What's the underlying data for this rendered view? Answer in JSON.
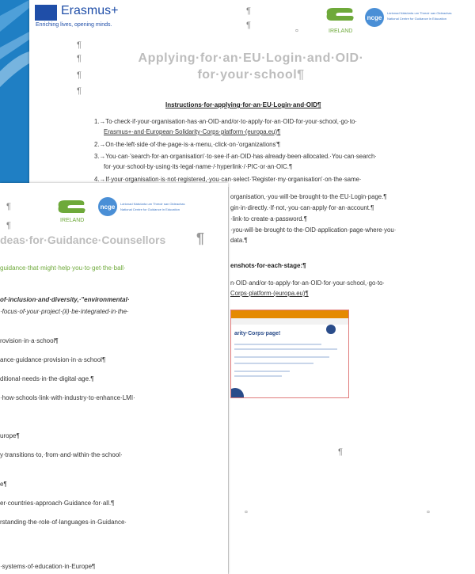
{
  "front": {
    "logo_text": "Erasmus+",
    "logo_tagline": "Enriching lives, opening minds.",
    "partner_text": "IRELAND",
    "ncge_text": "ncge",
    "partner_line1": "Lárionad Náisiúnta um Threoir san Oideachas",
    "partner_line2": "National Centre for Guidance in Education",
    "pilcrow": "¶",
    "title_line1": "Applying·for·an·EU·Login·and·OID·",
    "title_line2": "for·your·school¶",
    "heading": "Instructions·for·applying·for·an·EU·Login·and·OID¶",
    "items": [
      "1.→To·check·if·your·organisation·has·an·OID·and/or·to·apply·for·an·OID·for·your·school,·go·to·",
      "Erasmus+·and·European·Solidarity·Corps·platform·(europa.eu)¶",
      "2.→On·the·left·side·of·the·page·is·a·menu,·click·on·'organizations'¶",
      "3.→You·can·'search·for·an·organisation'·to·see·if·an·OID·has·already·been·allocated.·You·can·search·",
      "for·your·school·by·using·its·legal·name·/·hyperlink·/·PIC·or·an·OIC.¶",
      "4.→If·your·organisation·is·not·registered,·you·can·select·'Register·my·organisation'·on·the·same·"
    ]
  },
  "right": {
    "lines": [
      "organisation,·you·will·be·brought·to·the·EU·Login·page.¶",
      "gin·in·directly.·If·not,·you·can·apply·for·an·account.¶",
      "·link·to·create·a·password.¶",
      "·you·will·be·brought·to·the·OID·application·page·where·you·",
      "data.¶"
    ],
    "heading": "enshots·for·each·stage:¶",
    "line2a": "n·OID·and/or·to·apply·for·an·OID·for·your·school,·go·to·",
    "line2b": "Corps·platform·(europa.eu)¶",
    "screenshot_title": "arity·Corps·page!",
    "pilcrow": "¶",
    "footer_mark": "¤"
  },
  "back": {
    "partner_text": "IRELAND",
    "ncge_text": "ncge",
    "partner_line1": "Lárionad Náisiúnta um Threoir san Oideachas",
    "partner_line2": "National Centre for Guidance in Education",
    "pilcrow": "¶",
    "title": "deas·for·Guidance·Counsellors",
    "subtitle": "guidance·that·might·help·you·to·get·the·ball·",
    "bold_line1": "of·inclusion·and·diversity,·\"environmental·",
    "bold_line2": "·focus·of·your·project·(ii)·be·integrated·in·the·",
    "lines": [
      "rovision·in·a·school¶",
      "ance·guidance·provision·in·a·school¶",
      "ditional·needs·in·the·digital·age.¶",
      "·how·schools·link·with·industry·to·enhance·LMI·",
      "urope¶",
      "y·transitions·to,·from·and·within·the·school·",
      "e¶",
      "er·countries·approach·Guidance·for·all.¶",
      "rstanding·the·role·of·languages·in·Guidance·",
      "·systems·of·education·in·Europe¶"
    ]
  },
  "colors": {
    "background": "#1f7fc4",
    "title_grey": "#bdbdbd",
    "link_blue": "#1f5fbf",
    "green": "#6ea93a",
    "orange": "#e58a00"
  }
}
